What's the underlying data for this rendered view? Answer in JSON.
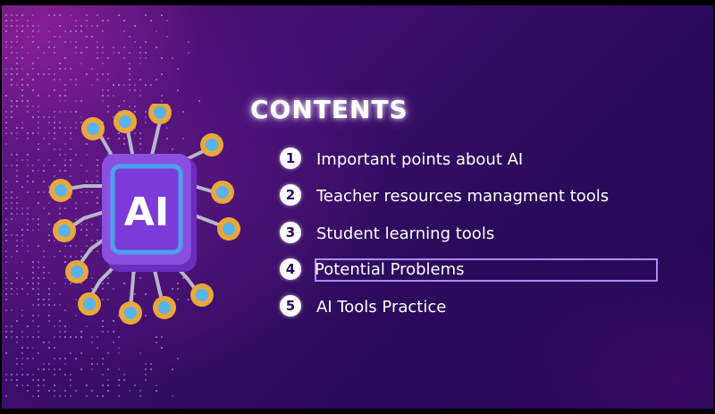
{
  "slide": {
    "title": "CONTENTS",
    "chip_label": "AI",
    "items": [
      {
        "number": "1",
        "label": "Important points about AI"
      },
      {
        "number": "2",
        "label": "Teacher resources managment tools"
      },
      {
        "number": "3",
        "label": "Student learning tools"
      },
      {
        "number": "4",
        "label": "Potential Problems"
      },
      {
        "number": "5",
        "label": "AI Tools Practice"
      }
    ],
    "selected_item": 4
  },
  "colors": {
    "background_dark": "#230853",
    "background_accent": "#5a1577",
    "chip_purple": "#8b4fe0",
    "chip_face": "#7c3ad8",
    "chip_border": "#4aa0ea",
    "node_gold": "#e9a73a",
    "node_blue": "#5ab2ea",
    "selection_outline": "#a98cf0"
  },
  "icons": {
    "chip": "ai-chip-icon",
    "list_marker": "numbered-circle-icon"
  }
}
